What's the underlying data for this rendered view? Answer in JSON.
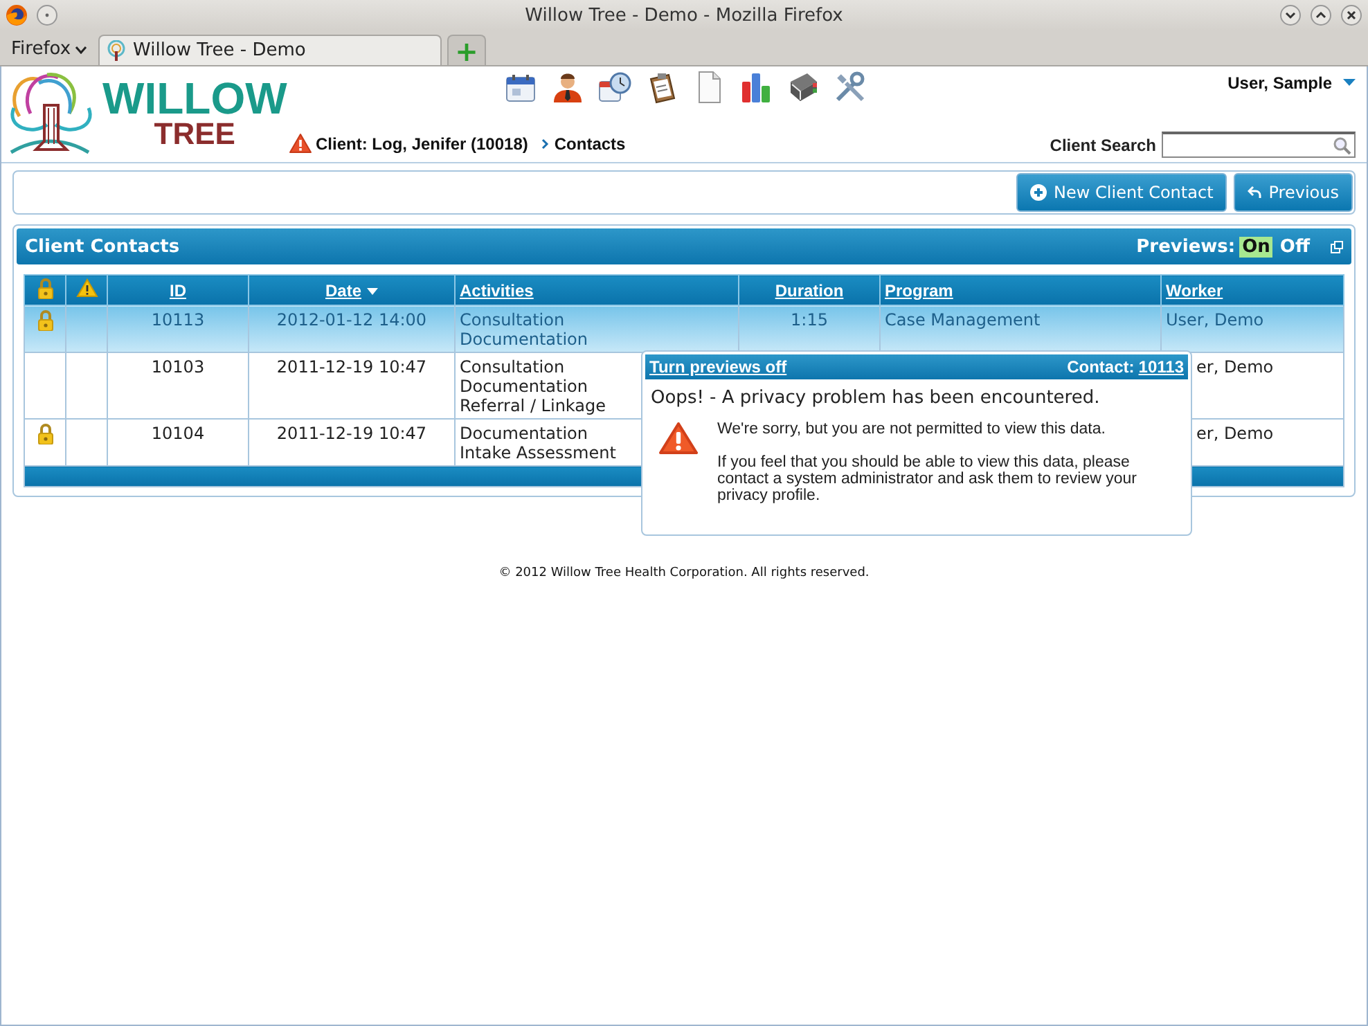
{
  "window": {
    "title": "Willow Tree - Demo - Mozilla Firefox",
    "app_menu": "Firefox",
    "tab": {
      "title": "Willow Tree - Demo",
      "selected": true
    },
    "new_tab": "+"
  },
  "header": {
    "logo": {
      "line_1": "WILLOW",
      "line_2": "TREE"
    },
    "user_menu": "User, Sample",
    "breadcrumb": [
      {
        "kind": "alert",
        "text": "Client: Log, Jenifer (10018)"
      },
      {
        "kind": "crumb",
        "text": "Contacts"
      }
    ],
    "search": {
      "label": "Client Search"
    }
  },
  "actions": [
    {
      "kind": "add",
      "label": "New Client Contact"
    },
    {
      "kind": "back",
      "label": "Previous"
    }
  ],
  "panel": {
    "title": "Client Contacts",
    "previews_label": "Previews:",
    "previews": [
      {
        "label": "On",
        "selected": true
      },
      {
        "label": "Off",
        "selected": false
      }
    ]
  },
  "table": {
    "columns": [
      {
        "kind": "lock"
      },
      {
        "kind": "warning"
      },
      {
        "kind": "text",
        "label": "ID",
        "sorted": false
      },
      {
        "kind": "text",
        "label": "Date",
        "sorted": true
      },
      {
        "kind": "text",
        "label": "Activities",
        "sorted": false
      },
      {
        "kind": "text",
        "label": "Duration",
        "sorted": false
      },
      {
        "kind": "text",
        "label": "Program",
        "sorted": false
      },
      {
        "kind": "text",
        "label": "Worker",
        "sorted": false
      }
    ],
    "rows": [
      {
        "locked": true,
        "selected": true,
        "cells": {
          "id": "10113",
          "date": "2012-01-12 14:00",
          "activities": [
            "Consultation",
            "Documentation"
          ],
          "duration": "1:15",
          "program": "Case Management",
          "worker": "User, Demo"
        }
      },
      {
        "locked": false,
        "selected": false,
        "cells": {
          "id": "10103",
          "date": "2011-12-19 10:47",
          "activities": [
            "Consultation",
            "Documentation",
            "Referral / Linkage"
          ],
          "worker_partial": "er, Demo"
        }
      },
      {
        "locked": true,
        "selected": false,
        "cells": {
          "id": "10104",
          "date": "2011-12-19 10:47",
          "activities": [
            "Documentation",
            "Intake Assessment"
          ],
          "worker_partial": "er, Demo"
        }
      }
    ]
  },
  "preview_popup": {
    "link": "Turn previews off",
    "contact_label": "Contact:",
    "contact_id": "10113",
    "heading": "Oops! - A privacy problem has been encountered.",
    "paragraphs": [
      "We're sorry, but you are not permitted to view this data.",
      "If you feel that you should be able to view this data, please contact a system administrator and ask them to review your privacy profile."
    ]
  },
  "footer": "© 2012 Willow Tree Health Corporation. All rights reserved."
}
